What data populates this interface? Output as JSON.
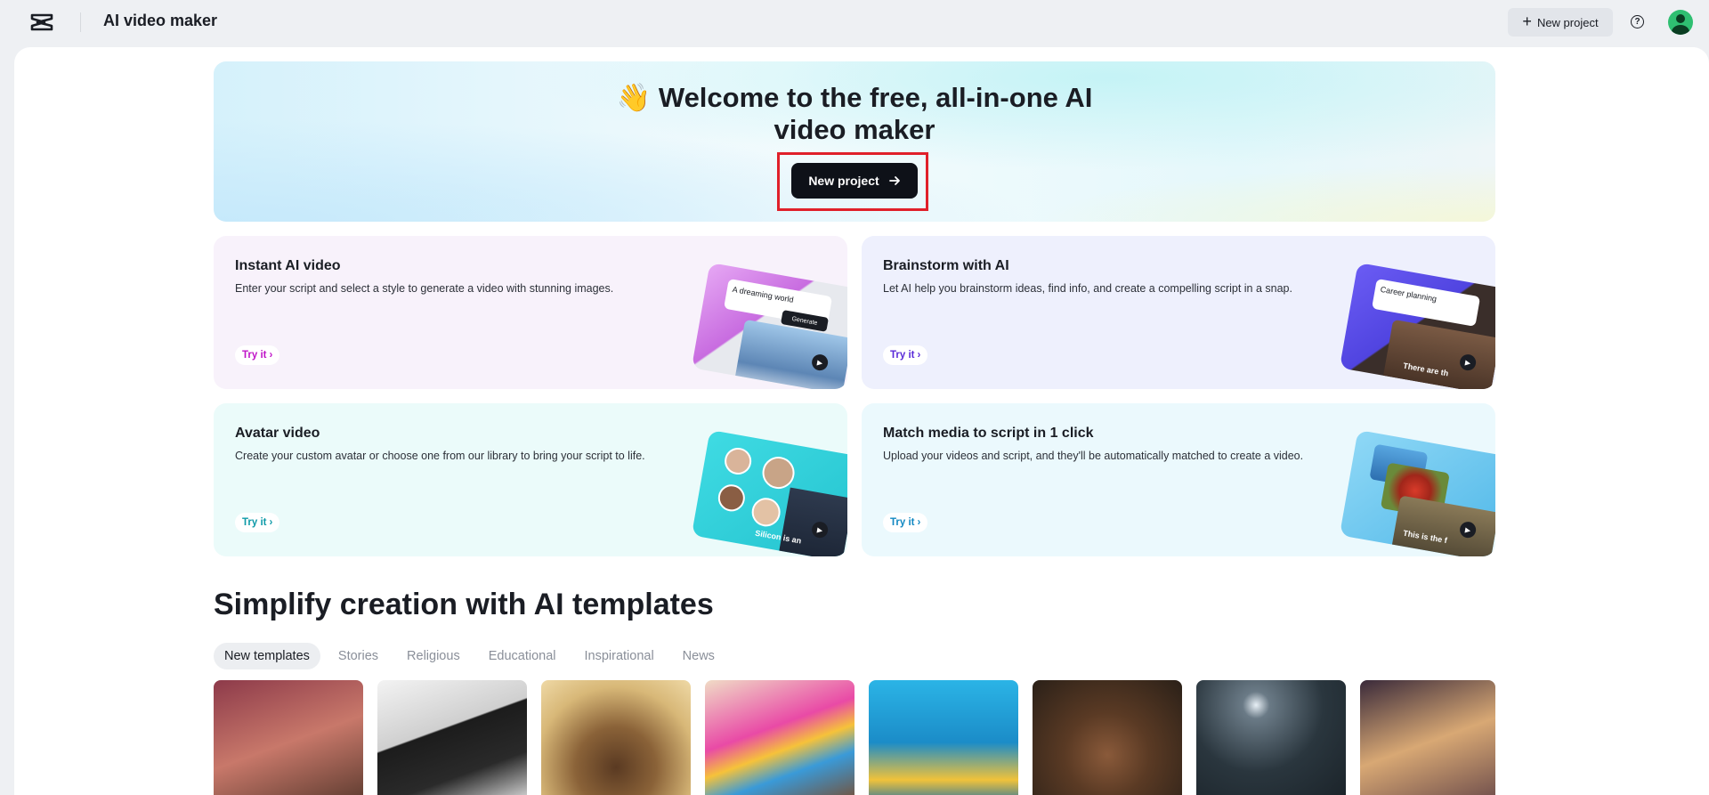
{
  "header": {
    "app_title": "AI video maker",
    "new_project_label": "New project",
    "help_icon": "?"
  },
  "hero": {
    "title": "👋 Welcome to the free, all-in-one AI video maker",
    "button_label": "New project"
  },
  "cards": [
    {
      "title": "Instant AI video",
      "desc": "Enter your script and select a style to generate a video with stunning images.",
      "try_label": "Try it",
      "accent": "#c014c8",
      "art_text": "A dreaming world",
      "art_button": "Generate"
    },
    {
      "title": "Brainstorm with AI",
      "desc": "Let AI help you brainstorm ideas, find info, and create a compelling script in a snap.",
      "try_label": "Try it",
      "accent": "#5a2bd8",
      "art_text": "Career planning",
      "art_caption": "There are th"
    },
    {
      "title": "Avatar video",
      "desc": "Create your custom avatar or choose one from our library to bring your script to life.",
      "try_label": "Try it",
      "accent": "#0e9aa8",
      "art_caption": "Silicon is an"
    },
    {
      "title": "Match media to script in 1 click",
      "desc": "Upload your videos and script, and they'll be automatically matched to create a video.",
      "try_label": "Try it",
      "accent": "#1288c2",
      "art_caption": "This is the f"
    }
  ],
  "templates": {
    "title": "Simplify creation with AI templates",
    "tabs": [
      "New templates",
      "Stories",
      "Religious",
      "Educational",
      "Inspirational",
      "News"
    ],
    "active_tab": "New templates"
  },
  "colors": {
    "primary_button": "#0e1118",
    "highlight_outline": "#e0202a",
    "avatar": "#2fbf71"
  }
}
